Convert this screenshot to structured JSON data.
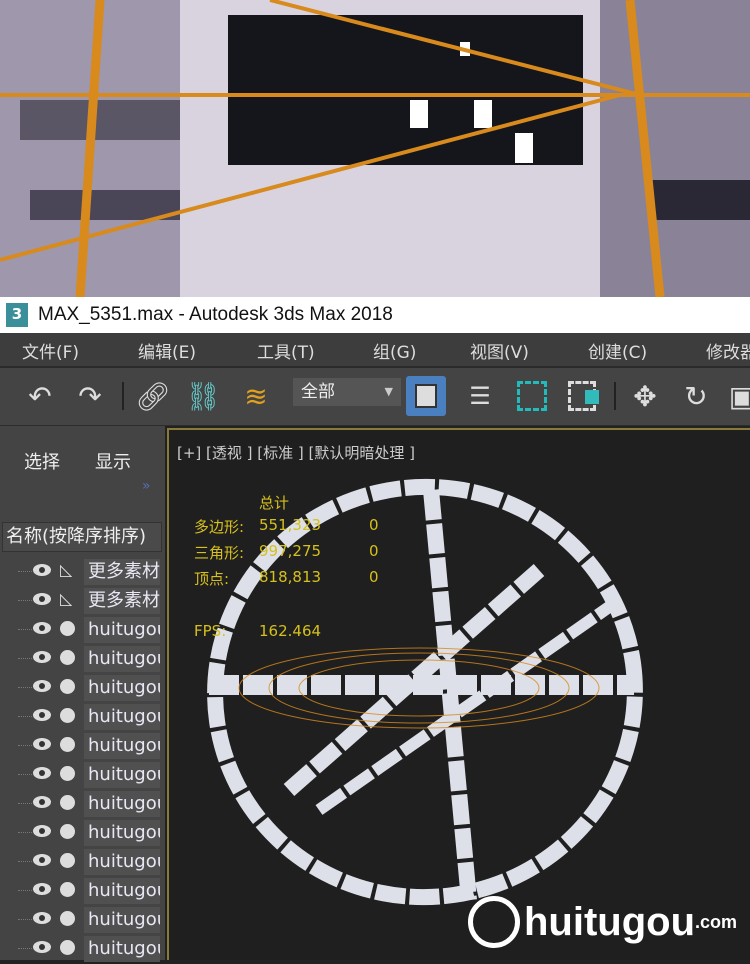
{
  "window": {
    "title": "MAX_5351.max - Autodesk 3ds Max 2018",
    "app_icon": "3"
  },
  "menu": [
    "文件(F)",
    "编辑(E)",
    "工具(T)",
    "组(G)",
    "视图(V)",
    "创建(C)",
    "修改器"
  ],
  "toolbar": {
    "selection_filter": "全部"
  },
  "left_panel": {
    "tabs": [
      "选择",
      "显示"
    ],
    "more": "»",
    "column_header": "名称(按降序排序)",
    "items": [
      "更多素材",
      "更多素材",
      "huitugou",
      "huitugou",
      "huitugou",
      "huitugou",
      "huitugou",
      "huitugou",
      "huitugou",
      "huitugou",
      "huitugou",
      "huitugou",
      "huitugou",
      "huitugou"
    ]
  },
  "viewport": {
    "label": "[+] [透视 ] [标准 ] [默认明暗处理 ]",
    "stats": {
      "header": "总计",
      "rows": [
        {
          "label": "多边形:",
          "total": "551,323",
          "sel": "0"
        },
        {
          "label": "三角形:",
          "total": "997,275",
          "sel": "0"
        },
        {
          "label": "顶点:",
          "total": "818,813",
          "sel": "0"
        }
      ],
      "fps_label": "FPS:",
      "fps": "162.464"
    }
  },
  "watermark": {
    "text": "huitugou",
    "suffix": ".com"
  },
  "colors": {
    "stat": "#d6c01c",
    "accent": "#4a7fc0"
  }
}
